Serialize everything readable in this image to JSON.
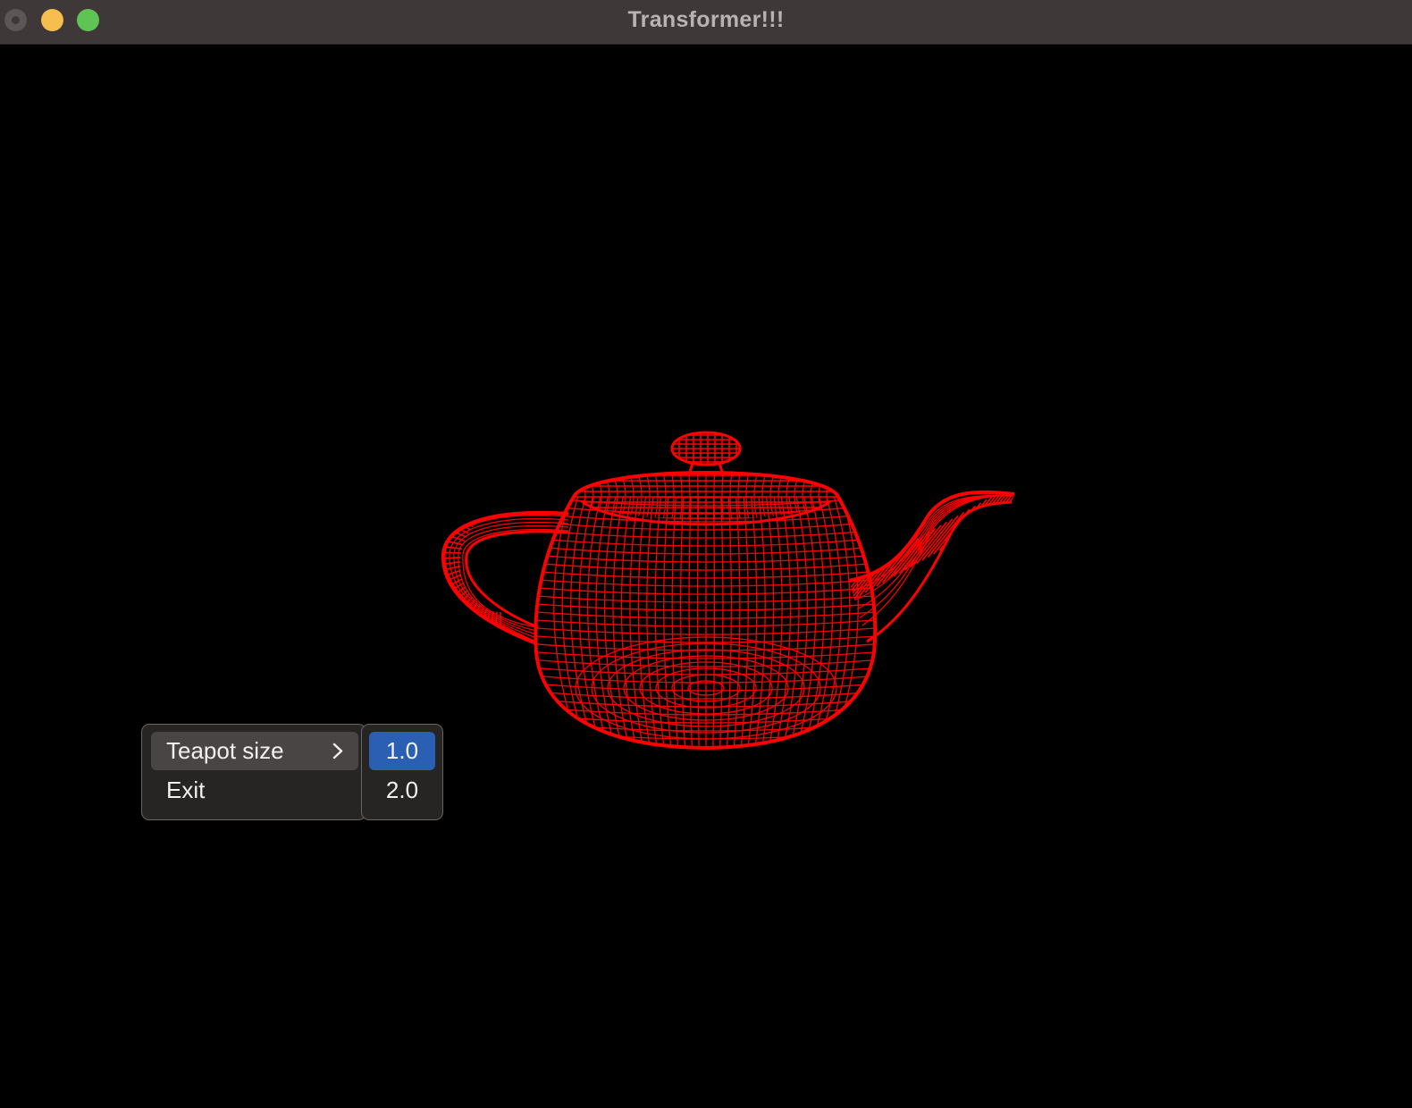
{
  "window": {
    "title": "Transformer!!!"
  },
  "colors": {
    "teapot_wireframe": "#ff0000",
    "background": "#000000",
    "menu_selected": "#2b5fb3"
  },
  "context_menu": {
    "items": [
      {
        "label": "Teapot size",
        "has_submenu": true,
        "highlighted": true
      },
      {
        "label": "Exit",
        "has_submenu": false,
        "highlighted": false
      }
    ]
  },
  "submenu": {
    "items": [
      {
        "label": "1.0",
        "selected": true
      },
      {
        "label": "2.0",
        "selected": false
      }
    ]
  },
  "icons": {
    "submenu_arrow": "chevron-right-icon",
    "close": "close-icon",
    "minimize": "minimize-icon",
    "zoom": "zoom-icon"
  }
}
